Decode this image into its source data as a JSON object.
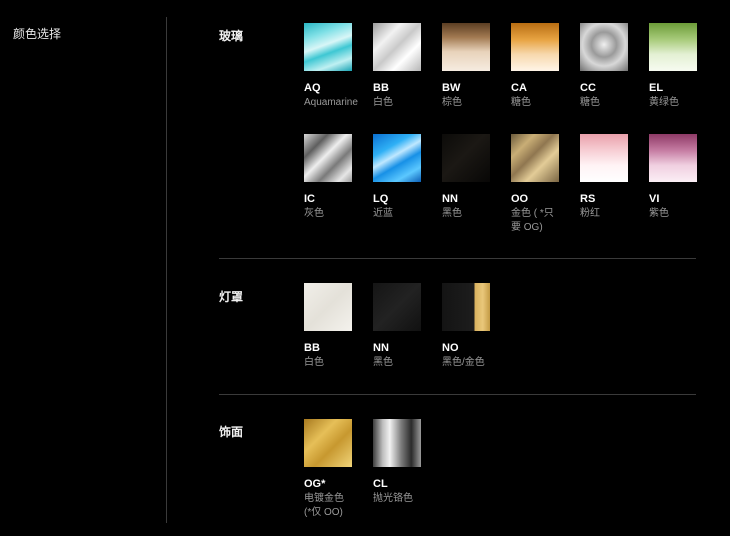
{
  "sidebar": {
    "title": "颜色选择"
  },
  "sections": {
    "glass": {
      "title": "玻璃",
      "items": [
        {
          "code": "AQ",
          "desc": "Aquamarine"
        },
        {
          "code": "BB",
          "desc": "白色"
        },
        {
          "code": "BW",
          "desc": "棕色"
        },
        {
          "code": "CA",
          "desc": "糖色"
        },
        {
          "code": "CC",
          "desc": "糖色"
        },
        {
          "code": "EL",
          "desc": "黄绿色"
        },
        {
          "code": "IC",
          "desc": "灰色"
        },
        {
          "code": "LQ",
          "desc": "近蓝"
        },
        {
          "code": "NN",
          "desc": "黑色"
        },
        {
          "code": "OO",
          "desc": "金色 ( *只",
          "desc2": "要 OG)"
        },
        {
          "code": "RS",
          "desc": "粉红"
        },
        {
          "code": "VI",
          "desc": "紫色"
        }
      ]
    },
    "shade": {
      "title": "灯罩",
      "items": [
        {
          "code": "BB",
          "desc": "白色"
        },
        {
          "code": "NN",
          "desc": "黑色"
        },
        {
          "code": "NO",
          "desc": "黑色/金色"
        }
      ]
    },
    "finish": {
      "title": "饰面",
      "items": [
        {
          "code": "OG*",
          "desc": "电镀金色",
          "desc2": "(*仅 OO)"
        },
        {
          "code": "CL",
          "desc": "抛光铬色"
        }
      ]
    }
  }
}
